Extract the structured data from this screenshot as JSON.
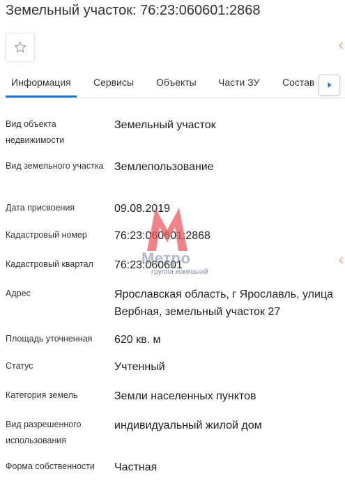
{
  "header": {
    "title": "Земельный участок: 76:23:060601:2868"
  },
  "favorite": {
    "icon": "star-outline-icon"
  },
  "tabs": [
    {
      "label": "Информация",
      "active": true
    },
    {
      "label": "Сервисы",
      "active": false
    },
    {
      "label": "Объекты",
      "active": false
    },
    {
      "label": "Части ЗУ",
      "active": false
    },
    {
      "label": "Состав",
      "active": false
    }
  ],
  "tabs_next_icon": "caret-right-icon",
  "colors": {
    "accent": "#1976d2",
    "edge_marker": "#ff7f50",
    "watermark_red": "#e8545a",
    "watermark_blue": "#6f82aa"
  },
  "fields": [
    {
      "label": "Вид объекта недвижимости",
      "value": "Земельный участок"
    },
    {
      "label": "Вид земельного участка",
      "value": "Землепользование"
    },
    {
      "label": "Дата присвоения",
      "value": "09.08.2019"
    },
    {
      "label": "Кадастровый номер",
      "value": "76:23:060601:2868"
    },
    {
      "label": "Кадастровый квартал",
      "value": "76:23:060601"
    },
    {
      "label": "Адрес",
      "value": "Ярославская область, г Ярославль, улица Вербная, земельный участок 27"
    },
    {
      "label": "Площадь уточненная",
      "value": "620 кв. м"
    },
    {
      "label": "Статус",
      "value": "Учтенный"
    },
    {
      "label": "Категория земель",
      "value": "Земли населенных пунктов"
    },
    {
      "label": "Вид разрешенного использования",
      "value": "индивидуальный жилой дом"
    },
    {
      "label": "Форма собственности",
      "value": "Частная"
    }
  ],
  "watermark": {
    "brand": "Метро",
    "subtitle": "группа компаний"
  }
}
